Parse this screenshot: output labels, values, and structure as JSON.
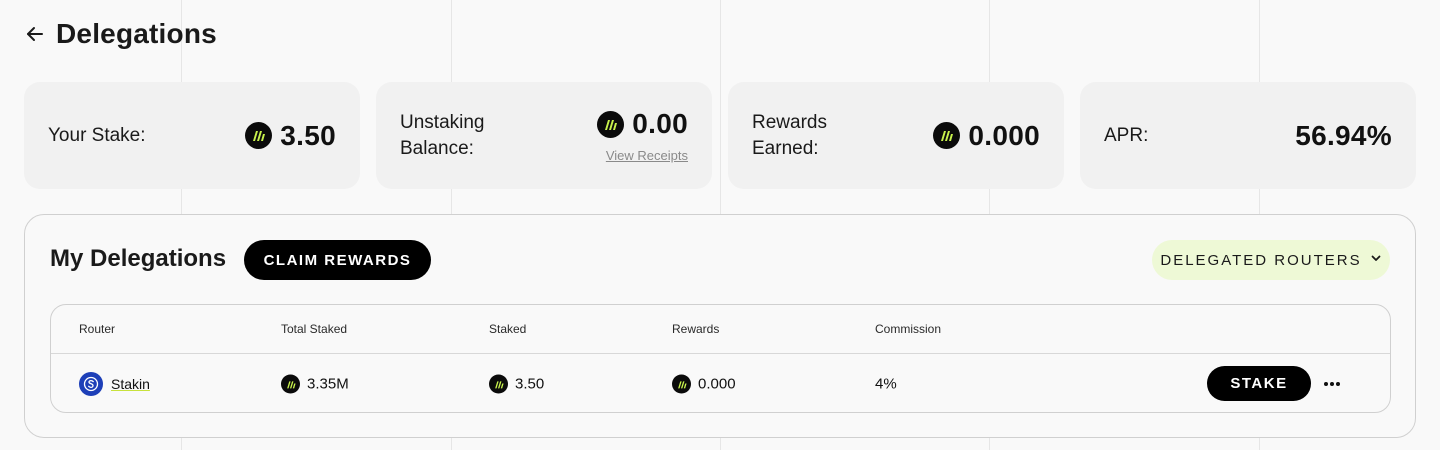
{
  "header": {
    "title": "Delegations"
  },
  "stats": {
    "your_stake": {
      "label": "Your Stake:",
      "value": "3.50"
    },
    "unstaking": {
      "label": "Unstaking Balance:",
      "value": "0.00",
      "link": "View Receipts"
    },
    "rewards": {
      "label": "Rewards Earned:",
      "value": "0.000"
    },
    "apr": {
      "label": "APR:",
      "value": "56.94%"
    }
  },
  "delegations": {
    "title": "My Delegations",
    "claim_label": "CLAIM REWARDS",
    "filter_label": "DELEGATED ROUTERS",
    "columns": [
      "Router",
      "Total Staked",
      "Staked",
      "Rewards",
      "Commission"
    ],
    "rows": [
      {
        "router": "Stakin",
        "total_staked": "3.35M",
        "staked": "3.50",
        "rewards": "0.000",
        "commission": "4%",
        "action_label": "STAKE"
      }
    ]
  },
  "icons": {
    "back": "arrow-left-icon",
    "token": "token-coin-icon",
    "router_avatar": "stakin-logo-icon",
    "dropdown": "chevron-down-icon",
    "more": "more-horizontal-icon"
  },
  "colors": {
    "background": "#f9f9f9",
    "card": "#f1f1f1",
    "accent": "#c8f24c",
    "filter_bg": "#eef9d6",
    "button": "#000000",
    "router_avatar": "#1d3fb8"
  }
}
